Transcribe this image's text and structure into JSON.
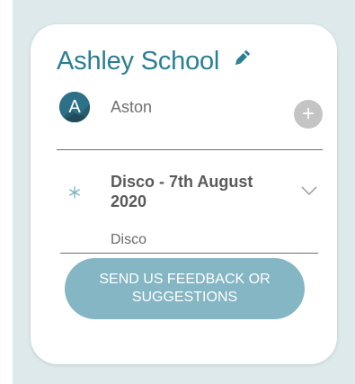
{
  "school": {
    "title": "Ashley School"
  },
  "user": {
    "initial": "A",
    "name": "Aston"
  },
  "add_button_label": "+",
  "event": {
    "title": "Disco - 7th August 2020",
    "subtitle": "Disco"
  },
  "feedback_button_label": "SEND US FEEDBACK OR SUGGESTIONS",
  "colors": {
    "accent": "#2b7f92",
    "button": "#85b6c3",
    "backdrop": "#dde9ea",
    "avatar": "#2e6f86"
  },
  "icons": {
    "edit": "pencil-icon",
    "add": "plus-icon",
    "event": "snowflake-icon",
    "expand": "chevron-down-icon"
  }
}
